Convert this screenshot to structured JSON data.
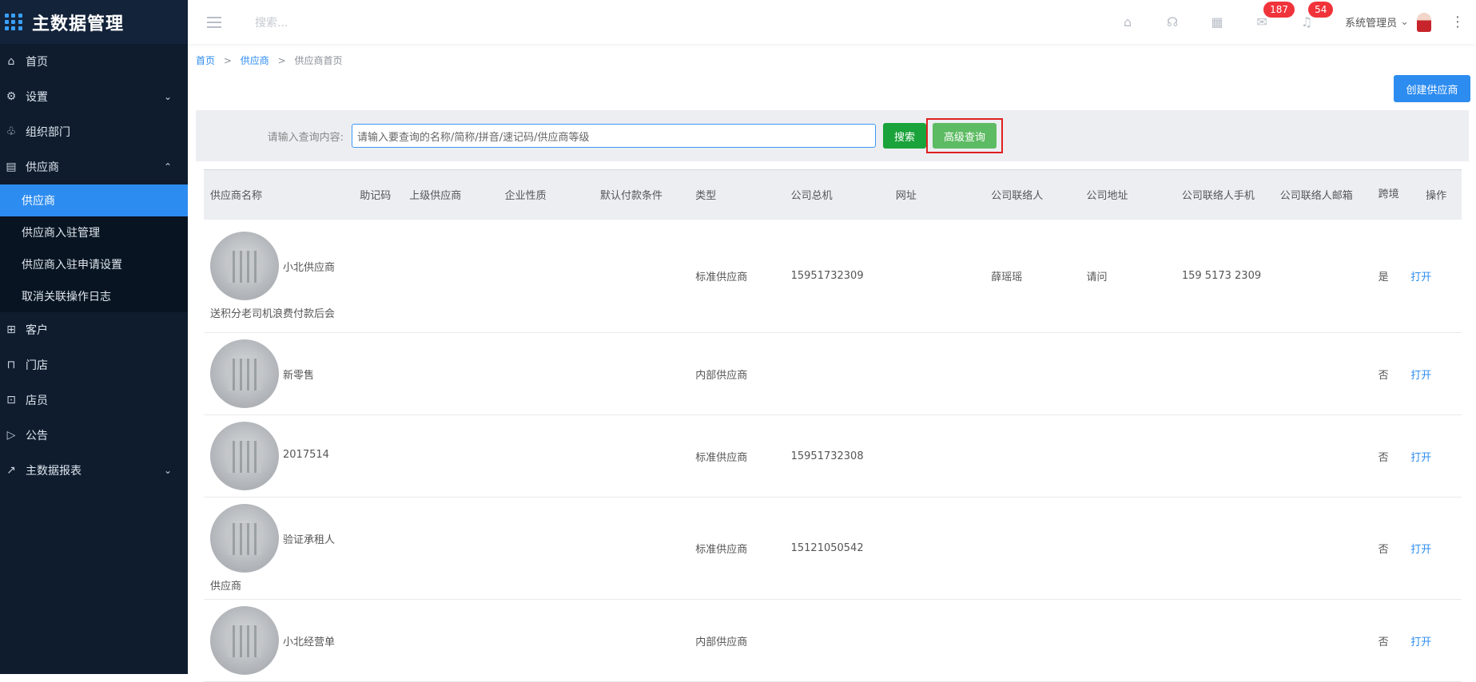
{
  "app": {
    "title": "主数据管理"
  },
  "sidebar": {
    "items": [
      {
        "label": "首页",
        "icon": "home-icon"
      },
      {
        "label": "设置",
        "icon": "gear-icon",
        "caret": "chevron-down"
      },
      {
        "label": "组织部门",
        "icon": "org-icon"
      },
      {
        "label": "供应商",
        "icon": "supplier-icon",
        "caret": "chevron-up",
        "expanded": true
      }
    ],
    "subitems": [
      {
        "label": "供应商",
        "active": true
      },
      {
        "label": "供应商入驻管理"
      },
      {
        "label": "供应商入驻申请设置"
      },
      {
        "label": "取消关联操作日志"
      }
    ],
    "items_after": [
      {
        "label": "客户",
        "icon": "customer-icon"
      },
      {
        "label": "门店",
        "icon": "store-icon"
      },
      {
        "label": "店员",
        "icon": "clerk-icon"
      },
      {
        "label": "公告",
        "icon": "notice-icon"
      },
      {
        "label": "主数据报表",
        "icon": "chart-icon",
        "caret": "chevron-down"
      }
    ]
  },
  "header": {
    "search_placeholder": "搜索...",
    "badge_messages": "187",
    "badge_notifications": "54",
    "user_name": "系统管理员"
  },
  "breadcrumb": {
    "home": "首页",
    "level1": "供应商",
    "current": "供应商首页",
    "sep": ">"
  },
  "actions": {
    "create_label": "创建供应商"
  },
  "query": {
    "label": "请输入查询内容:",
    "placeholder": "请输入要查询的名称/简称/拼音/速记码/供应商等级",
    "search_label": "搜索",
    "advanced_label": "高级查询"
  },
  "table": {
    "columns": [
      "供应商名称",
      "助记码",
      "上级供应商",
      "企业性质",
      "默认付款条件",
      "类型",
      "公司总机",
      "网址",
      "公司联络人",
      "公司地址",
      "公司联络人手机",
      "公司联络人邮箱",
      "跨境",
      "操作"
    ],
    "rows": [
      {
        "name": "小北供应商",
        "name_extra": "送积分老司机浪费付款后会",
        "type": "标准供应商",
        "phone": "15951732309",
        "contact": "薛瑶瑶",
        "address": "请问",
        "mobile": "159 5173 2309",
        "cross": "是",
        "action": "打开"
      },
      {
        "name": "新零售",
        "name_extra": "",
        "type": "内部供应商",
        "phone": "",
        "contact": "",
        "address": "",
        "mobile": "",
        "cross": "否",
        "action": "打开"
      },
      {
        "name": "2017514",
        "name_extra": "",
        "type": "标准供应商",
        "phone": "15951732308",
        "contact": "",
        "address": "",
        "mobile": "",
        "cross": "否",
        "action": "打开"
      },
      {
        "name": "验证承租人",
        "name_extra": "供应商",
        "type": "标准供应商",
        "phone": "15121050542",
        "contact": "",
        "address": "",
        "mobile": "",
        "cross": "否",
        "action": "打开"
      },
      {
        "name": "小北经营单",
        "name_extra": "",
        "type": "内部供应商",
        "phone": "",
        "contact": "",
        "address": "",
        "mobile": "",
        "cross": "否",
        "action": "打开"
      }
    ]
  }
}
